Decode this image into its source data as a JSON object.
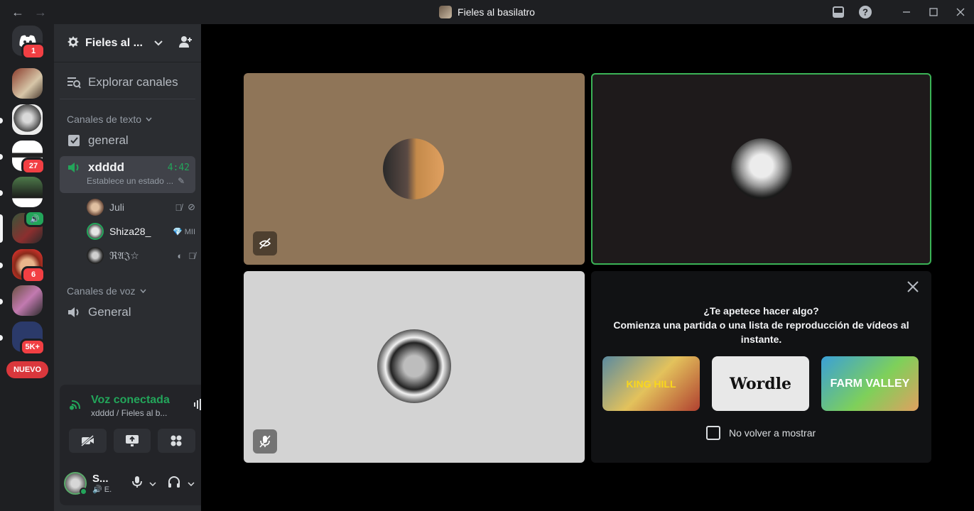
{
  "window": {
    "title": "Fieles al basilatro",
    "back_icon": "←",
    "forward_icon": "→"
  },
  "guilds": {
    "home_badge": "1",
    "items": [
      {
        "badge": ""
      },
      {
        "badge": ""
      },
      {
        "badge": "27"
      },
      {
        "badge": ""
      },
      {
        "badge": ""
      },
      {
        "badge": "6"
      },
      {
        "badge": ""
      },
      {
        "badge": "5K+"
      }
    ],
    "new_label": "NUEVO"
  },
  "server": {
    "name": "Fieles al ...",
    "explore_label": "Explorar canales"
  },
  "text_category": {
    "label": "Canales de texto"
  },
  "text_channels": [
    {
      "name": "general"
    }
  ],
  "voice_active": {
    "name": "xdddd",
    "time": "4:42",
    "status": "Establece un estado ..."
  },
  "voice_users": [
    {
      "name": "Juli",
      "extra": ""
    },
    {
      "name": "Shiza28_",
      "extra": "💎 MII"
    },
    {
      "name": "ℜ𝔄𝔍☆",
      "extra": ""
    }
  ],
  "voice_category": {
    "label": "Canales de voz"
  },
  "voice_channels": [
    {
      "name": "General"
    }
  ],
  "voice_connection": {
    "title": "Voz conectada",
    "subtitle": "xdddd / Fieles al b..."
  },
  "user": {
    "name": "S...",
    "status": "E."
  },
  "activity": {
    "question": "¿Te apetece hacer algo?",
    "prompt": "Comienza una partida o una lista de reproducción de vídeos al instante.",
    "games": [
      "KING HILL",
      "Wordle",
      "FARM VALLEY"
    ],
    "no_show_label": "No volver a mostrar"
  },
  "colors": {
    "accent_green": "#23a55a",
    "badge_red": "#f23f43",
    "speaking_border": "#3bb356"
  }
}
